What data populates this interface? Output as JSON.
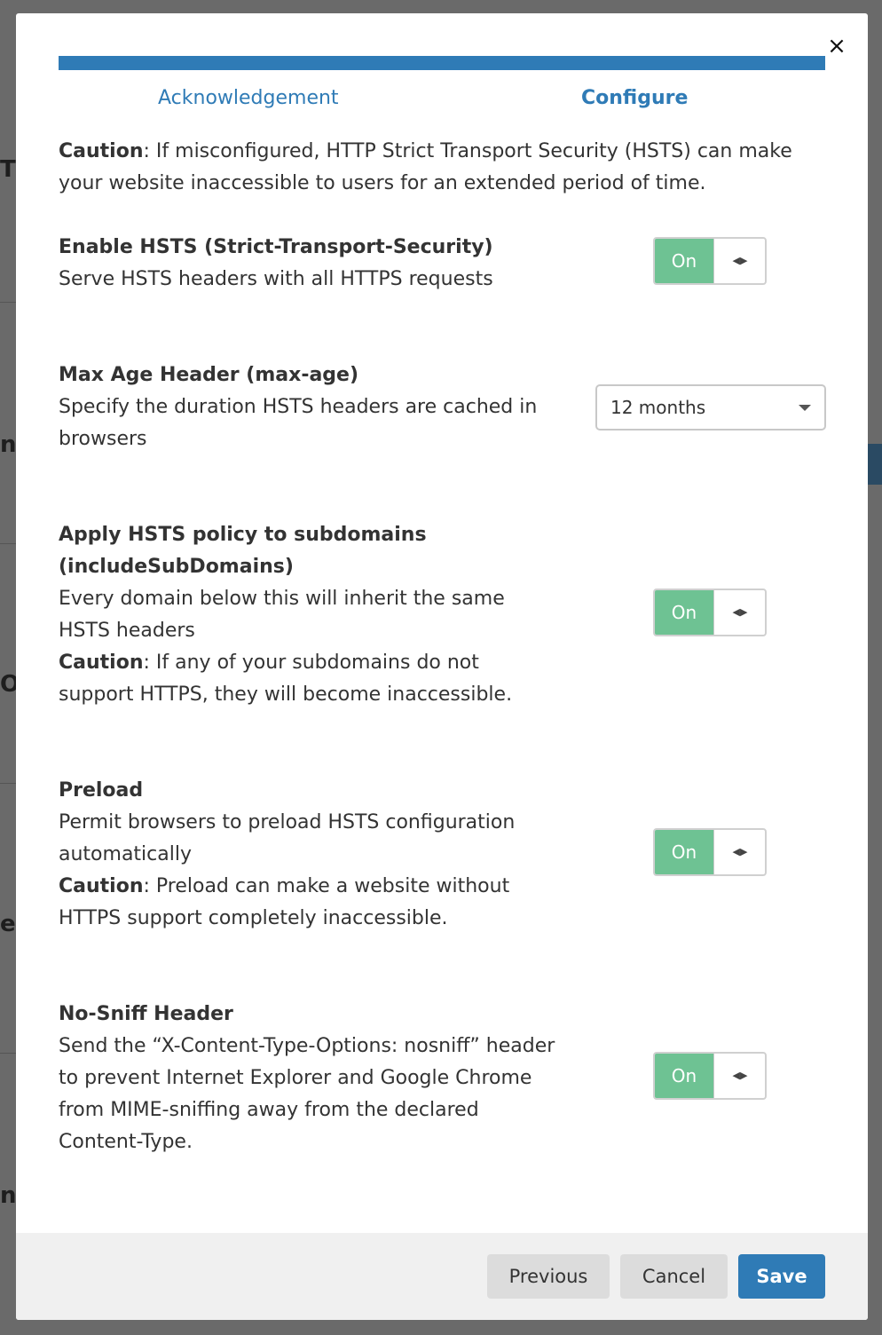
{
  "modal": {
    "close_glyph": "×",
    "steps": [
      {
        "label": "Acknowledgement",
        "active": false
      },
      {
        "label": "Configure",
        "active": true
      }
    ],
    "caution": {
      "prefix": "Caution",
      "text": ": If misconfigured, HTTP Strict Transport Security (HSTS) can make your website inaccessible to users for an extended period of time."
    },
    "settings": {
      "hsts": {
        "title": "Enable HSTS (Strict-Transport-Security)",
        "description": "Serve HSTS headers with all HTTPS requests",
        "toggle_label": "On",
        "enabled": true
      },
      "max_age": {
        "title": "Max Age Header (max-age)",
        "description": "Specify the duration HSTS headers are cached in browsers",
        "selected": "12 months"
      },
      "subdomains": {
        "title": "Apply HSTS policy to subdomains (includeSubDomains)",
        "description": "Every domain below this will inherit the same HSTS headers",
        "caution_prefix": "Caution",
        "caution_text": ": If any of your subdomains do not support HTTPS, they will become inaccessible.",
        "toggle_label": "On",
        "enabled": true
      },
      "preload": {
        "title": "Preload",
        "description": "Permit browsers to preload HSTS configuration automatically",
        "caution_prefix": "Caution",
        "caution_text": ": Preload can make a website without HTTPS support completely inaccessible.",
        "toggle_label": "On",
        "enabled": true
      },
      "nosniff": {
        "title": "No-Sniff Header",
        "description": "Send the “X-Content-Type-Options: nosniff” header to prevent Internet Explorer and Google Chrome from MIME-sniffing away from the declared Content-Type.",
        "toggle_label": "On",
        "enabled": true
      }
    },
    "footer": {
      "previous_label": "Previous",
      "cancel_label": "Cancel",
      "save_label": "Save"
    }
  },
  "colors": {
    "accent": "#2f7bb6",
    "toggle_on": "#6ec293",
    "footer_bg": "#f0f0f0"
  }
}
